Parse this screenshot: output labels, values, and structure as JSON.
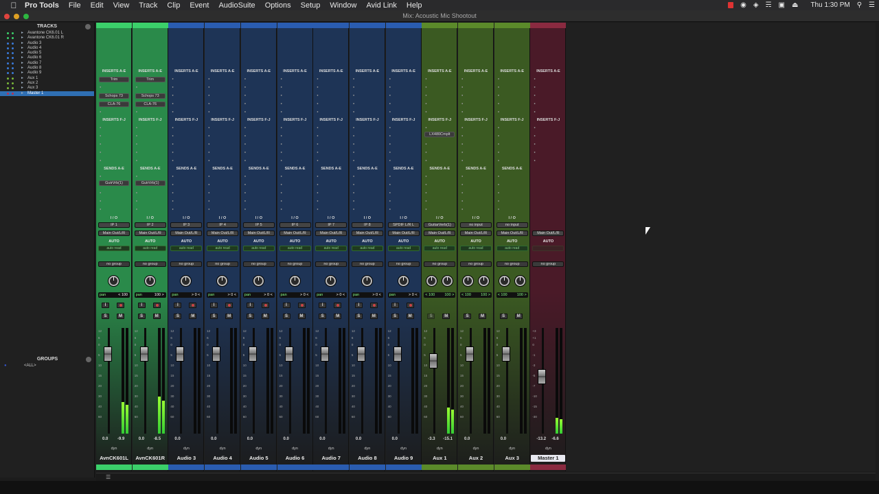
{
  "menubar": {
    "app_name": "Pro Tools",
    "items": [
      "File",
      "Edit",
      "View",
      "Track",
      "Clip",
      "Event",
      "AudioSuite",
      "Options",
      "Setup",
      "Window",
      "Avid Link",
      "Help"
    ],
    "clock": "Thu 1:30 PM"
  },
  "window": {
    "title": "Mix: Acoustic Mic Shootout"
  },
  "tracks_panel": {
    "header": "TRACKS",
    "items": [
      {
        "label": "Avantone CK6.01 L",
        "color": "#3bd06a"
      },
      {
        "label": "Avantone CK6.01 R",
        "color": "#3bd06a"
      },
      {
        "label": "Audio 3",
        "color": "#3a7ad8"
      },
      {
        "label": "Audio 4",
        "color": "#3a7ad8"
      },
      {
        "label": "Audio 5",
        "color": "#3a7ad8"
      },
      {
        "label": "Audio 6",
        "color": "#3a7ad8"
      },
      {
        "label": "Audio 7",
        "color": "#3a7ad8"
      },
      {
        "label": "Audio 8",
        "color": "#3a7ad8"
      },
      {
        "label": "Audio 9",
        "color": "#3a7ad8"
      },
      {
        "label": "Aux 1",
        "color": "#7ab83a"
      },
      {
        "label": "Aux 2",
        "color": "#7ab83a"
      },
      {
        "label": "Aux 3",
        "color": "#7ab83a"
      },
      {
        "label": "Master 1",
        "color": "#c0304a",
        "selected": true
      }
    ]
  },
  "groups_panel": {
    "header": "GROUPS",
    "items": [
      "<ALL>"
    ]
  },
  "labels": {
    "inserts_ae": "INSERTS A-E",
    "inserts_fj": "INSERTS F-J",
    "sends_ae": "SENDS A-E",
    "io": "I / O",
    "auto": "AUTO",
    "auto_read": "auto read",
    "no_group": "no group",
    "pan": "pan",
    "dyn": "dyn",
    "s": "S",
    "m": "M",
    "i": "I",
    "scale": [
      "12",
      "6",
      "0",
      "5",
      "10",
      "15",
      "20",
      "30",
      "40",
      "60"
    ],
    "master_scale": [
      "+3",
      "+1",
      "0",
      "-1",
      "-3",
      "-5",
      "-7",
      "-10",
      "-15",
      "-30"
    ]
  },
  "strips": [
    {
      "name": "AvnCK601L",
      "type": "audio",
      "color": "#2a8a4a",
      "hl": "#3bd06a",
      "inserts": [
        "Trim",
        "",
        "Schops 73",
        "CLA-76"
      ],
      "insert_fj": "",
      "send": "GutrVrb(1)",
      "input": "IP 1",
      "output": "Main Out/L/R",
      "pan": "pan",
      "pan_l": "< 100",
      "pan_r": "",
      "vol": "0.0",
      "peak": "-9.9",
      "meter": 0.3
    },
    {
      "name": "AvnCK601R",
      "type": "audio",
      "color": "#2a8a4a",
      "hl": "#3bd06a",
      "inserts": [
        "Trim",
        "",
        "Schops 73",
        "CLA-76"
      ],
      "insert_fj": "",
      "send": "GutrVrb(1)",
      "input": "IP 2",
      "output": "Main Out/L/R",
      "pan": "pan",
      "pan_l": "100 >",
      "pan_r": "",
      "vol": "0.0",
      "peak": "-8.5",
      "meter": 0.35
    },
    {
      "name": "Audio 3",
      "type": "audio",
      "color": "#1e3456",
      "hl": "#2a5cb0",
      "inserts": [],
      "insert_fj": "",
      "send": "",
      "input": "IP 3",
      "output": "Main Out/L/R",
      "pan": "pan",
      "pan_l": "> 0 <",
      "pan_r": "",
      "vol": "0.0",
      "peak": "",
      "meter": 0
    },
    {
      "name": "Audio 4",
      "type": "audio",
      "color": "#1e3456",
      "hl": "#2a5cb0",
      "inserts": [],
      "insert_fj": "",
      "send": "",
      "input": "IP 4",
      "output": "Main Out/L/R",
      "pan": "pan",
      "pan_l": "> 0 <",
      "pan_r": "",
      "vol": "0.0",
      "peak": "",
      "meter": 0
    },
    {
      "name": "Audio 5",
      "type": "audio",
      "color": "#1e3456",
      "hl": "#2a5cb0",
      "inserts": [],
      "insert_fj": "",
      "send": "",
      "input": "IP 5",
      "output": "Main Out/L/R",
      "pan": "pan",
      "pan_l": "> 0 <",
      "pan_r": "",
      "vol": "0.0",
      "peak": "",
      "meter": 0
    },
    {
      "name": "Audio 6",
      "type": "audio",
      "color": "#1e3456",
      "hl": "#2a5cb0",
      "inserts": [],
      "insert_fj": "",
      "send": "",
      "input": "IP 6",
      "output": "Main Out/L/R",
      "pan": "pan",
      "pan_l": "> 0 <",
      "pan_r": "",
      "vol": "0.0",
      "peak": "",
      "meter": 0
    },
    {
      "name": "Audio 7",
      "type": "audio",
      "color": "#1e3456",
      "hl": "#2a5cb0",
      "inserts": [],
      "insert_fj": "",
      "send": "",
      "input": "IP 7",
      "output": "Main Out/L/R",
      "pan": "pan",
      "pan_l": "> 0 <",
      "pan_r": "",
      "vol": "0.0",
      "peak": "",
      "meter": 0
    },
    {
      "name": "Audio 8",
      "type": "audio",
      "color": "#1e3456",
      "hl": "#2a5cb0",
      "inserts": [],
      "insert_fj": "",
      "send": "",
      "input": "IP 8",
      "output": "Main Out/L/R",
      "pan": "pan",
      "pan_l": "> 0 <",
      "pan_r": "",
      "vol": "0.0",
      "peak": "",
      "meter": 0
    },
    {
      "name": "Audio 9",
      "type": "audio",
      "color": "#1e3456",
      "hl": "#2a5cb0",
      "inserts": [],
      "insert_fj": "",
      "send": "",
      "input": "SPDIF L/R L",
      "output": "Main Out/L/R",
      "pan": "pan",
      "pan_l": "> 0 <",
      "pan_r": "",
      "vol": "0.0",
      "peak": "",
      "meter": 0
    },
    {
      "name": "Aux 1",
      "type": "aux",
      "color": "#3b5a22",
      "hl": "#5b8a2a",
      "inserts": [],
      "insert_fj": "LX480Cmplt",
      "send": "",
      "input": "GuitarVerb(1)",
      "output": "Main Out/L/R",
      "pan": "",
      "pan_l": "< 100",
      "pan_r": "100 >",
      "vol": "-3.3",
      "peak": "-15.1",
      "meter": 0.25
    },
    {
      "name": "Aux 2",
      "type": "aux",
      "color": "#3b5a22",
      "hl": "#5b8a2a",
      "inserts": [],
      "insert_fj": "",
      "send": "",
      "input": "no input",
      "output": "Main Out/L/R",
      "pan": "",
      "pan_l": "< 100",
      "pan_r": "100 >",
      "vol": "0.0",
      "peak": "",
      "meter": 0
    },
    {
      "name": "Aux 3",
      "type": "aux",
      "color": "#3b5a22",
      "hl": "#5b8a2a",
      "inserts": [],
      "insert_fj": "",
      "send": "",
      "input": "no input",
      "output": "Main Out/L/R",
      "pan": "",
      "pan_l": "< 100",
      "pan_r": "100 >",
      "vol": "0.0",
      "peak": "",
      "meter": 0
    },
    {
      "name": "Master 1",
      "type": "master",
      "color": "#4a1a28",
      "hl": "#8a2a40",
      "inserts": [],
      "insert_fj": "",
      "send": "",
      "input": "",
      "output": "Main Out/L/R",
      "pan": "",
      "pan_l": "",
      "pan_r": "",
      "vol": "-13.2",
      "peak": "-6.6",
      "meter": 0.15
    }
  ]
}
